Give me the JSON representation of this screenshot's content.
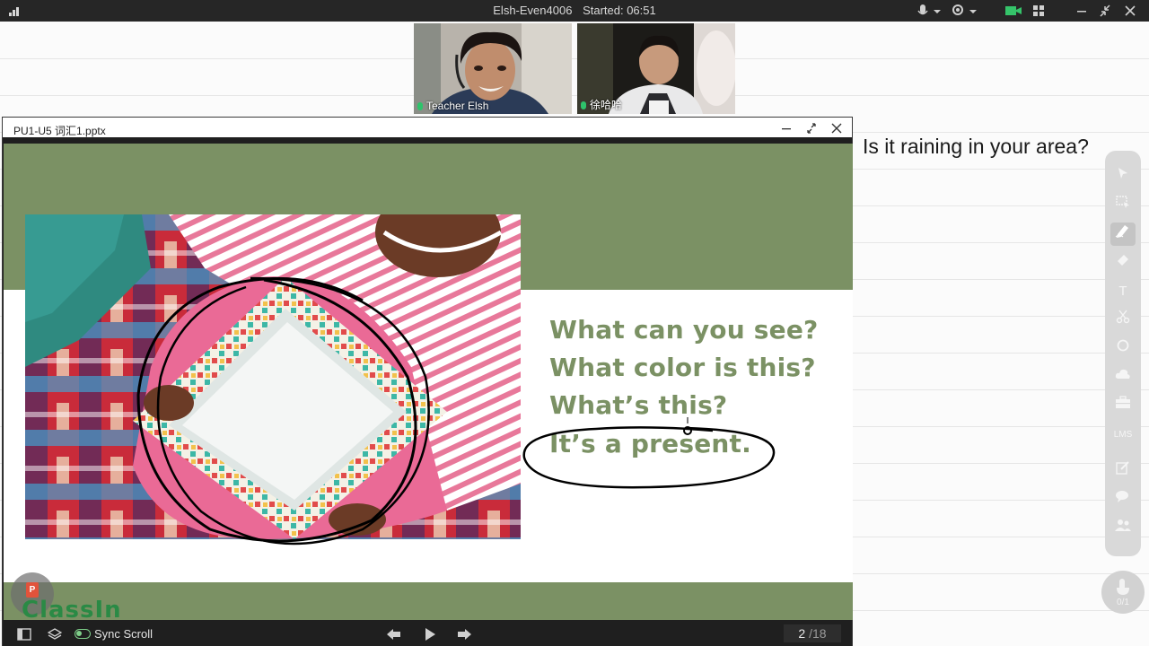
{
  "topbar": {
    "room": "Elsh-Even4006",
    "started": "Started: 06:51"
  },
  "videos": [
    {
      "name": "Teacher Elsh"
    },
    {
      "name": "徐哈哈"
    }
  ],
  "slide_window": {
    "filename": "PU1-U5 词汇1.pptx",
    "lines": [
      "What can you see?",
      "What color is this?",
      "What’s this?",
      "It’s a present."
    ],
    "brand": "ClassIn",
    "sync_label": "Sync Scroll",
    "page_current": "2",
    "page_total": "/18"
  },
  "question": "Is it raining in your area?",
  "tools": [
    {
      "name": "pointer-icon"
    },
    {
      "name": "select-icon"
    },
    {
      "name": "pen-icon",
      "active": true
    },
    {
      "name": "eraser-icon"
    },
    {
      "name": "text-icon",
      "glyph": "T"
    },
    {
      "name": "scissors-icon"
    },
    {
      "name": "shape-icon"
    },
    {
      "name": "cloud-icon"
    },
    {
      "name": "toolbox-icon"
    },
    {
      "name": "lms-icon",
      "glyph": "LMS"
    },
    {
      "name": "edit-icon"
    },
    {
      "name": "chat-icon"
    },
    {
      "name": "users-icon"
    }
  ],
  "raise_hand": {
    "count": "0/1"
  },
  "colors": {
    "slide_green": "#7b9164",
    "brand_green": "#2a8a45",
    "topbar": "#262626",
    "ink": "#000000"
  }
}
